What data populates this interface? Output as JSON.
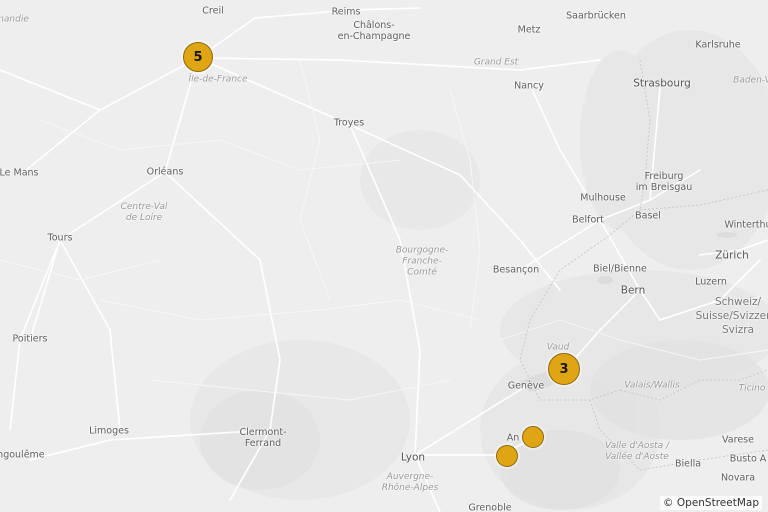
{
  "map": {
    "labels": [
      {
        "text": "Creil",
        "kind": "city"
      },
      {
        "text": "Reims",
        "kind": "city"
      },
      {
        "text": "Châlons-\nen-Champagne",
        "kind": "city"
      },
      {
        "text": "Metz",
        "kind": "city"
      },
      {
        "text": "Saarbrücken",
        "kind": "city"
      },
      {
        "text": "Karlsruhe",
        "kind": "city"
      },
      {
        "text": "Grand Est",
        "kind": "region"
      },
      {
        "text": "Nancy",
        "kind": "city"
      },
      {
        "text": "Strasbourg",
        "kind": "bigcity"
      },
      {
        "text": "Baden-V",
        "kind": "region"
      },
      {
        "text": "mandie",
        "kind": "region"
      },
      {
        "text": "Île-de-France",
        "kind": "region"
      },
      {
        "text": "Troyes",
        "kind": "city"
      },
      {
        "text": "Le Mans",
        "kind": "city"
      },
      {
        "text": "Orléans",
        "kind": "city"
      },
      {
        "text": "Mulhouse",
        "kind": "city"
      },
      {
        "text": "Freiburg\nim Breisgau",
        "kind": "city"
      },
      {
        "text": "Centre-Val\nde Loire",
        "kind": "region"
      },
      {
        "text": "Belfort",
        "kind": "city"
      },
      {
        "text": "Basel",
        "kind": "city"
      },
      {
        "text": "Winterthu",
        "kind": "city"
      },
      {
        "text": "Tours",
        "kind": "city"
      },
      {
        "text": "Bourgogne-\nFranche-\nComté",
        "kind": "region"
      },
      {
        "text": "Besançon",
        "kind": "city"
      },
      {
        "text": "Biel/Bienne",
        "kind": "city"
      },
      {
        "text": "Zürich",
        "kind": "bigcity"
      },
      {
        "text": "Luzern",
        "kind": "city"
      },
      {
        "text": "Bern",
        "kind": "bigcity"
      },
      {
        "text": "Schweiz/\nSuisse/Svizzera/\nSvizra",
        "kind": "country"
      },
      {
        "text": "Poitiers",
        "kind": "city"
      },
      {
        "text": "Vaud",
        "kind": "region"
      },
      {
        "text": "Genève",
        "kind": "city"
      },
      {
        "text": "Valais/Wallis",
        "kind": "region"
      },
      {
        "text": "Ticino",
        "kind": "region"
      },
      {
        "text": "Limoges",
        "kind": "city"
      },
      {
        "text": "Clermont-\nFerrand",
        "kind": "city"
      },
      {
        "text": "An",
        "kind": "city"
      },
      {
        "text": "Lyon",
        "kind": "bigcity"
      },
      {
        "text": "Valle d'Aosta /\nVallée d'Aoste",
        "kind": "region"
      },
      {
        "text": "Varese",
        "kind": "city"
      },
      {
        "text": "Busto A",
        "kind": "city"
      },
      {
        "text": "Biella",
        "kind": "city"
      },
      {
        "text": "Novara",
        "kind": "city"
      },
      {
        "text": "angoulême",
        "kind": "city"
      },
      {
        "text": "Auvergne-\nRhône-Alpes",
        "kind": "region"
      },
      {
        "text": "Grenoble",
        "kind": "city"
      }
    ],
    "markers": [
      {
        "count": "5"
      },
      {
        "count": "3"
      },
      {
        "count": ""
      },
      {
        "count": ""
      }
    ],
    "attribution": "© OpenStreetMap",
    "colors": {
      "background": "#eeeeee",
      "marker_fill": "#e0a512",
      "marker_border": "#8a6a10",
      "roads": "#ffffff",
      "borders": "#c9c9c9"
    }
  }
}
